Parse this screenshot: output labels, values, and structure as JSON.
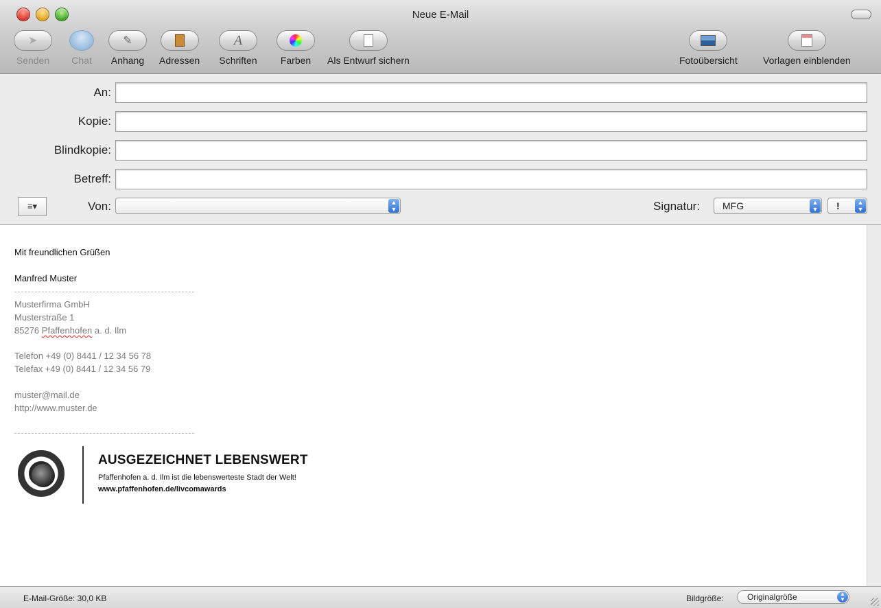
{
  "window": {
    "title": "Neue E-Mail"
  },
  "toolbar": {
    "send": "Senden",
    "chat": "Chat",
    "attach": "Anhang",
    "addresses": "Adressen",
    "fonts": "Schriften",
    "colors": "Farben",
    "draft": "Als Entwurf sichern",
    "photos": "Fotoübersicht",
    "templates": "Vorlagen einblenden"
  },
  "fields": {
    "to_label": "An:",
    "cc_label": "Kopie:",
    "bcc_label": "Blindkopie:",
    "subject_label": "Betreff:",
    "from_label": "Von:",
    "signature_label": "Signatur:",
    "signature_value": "MFG",
    "priority_value": "!"
  },
  "body": {
    "greeting": "Mit freundlichen Grüßen",
    "name": "Manfred Muster",
    "company": "Musterfirma GmbH",
    "street": "Musterstraße 1",
    "zip": "85276",
    "city_misspelled": "Pfaffenhofen",
    "city_rest": "a. d. Ilm",
    "phone": "Telefon +49 (0) 8441 / 12 34 56 78",
    "fax": "Telefax +49 (0) 8441 / 12 34 56 79",
    "email": "muster@mail.de",
    "web": "http://www.muster.de",
    "award_title": "AUSGEZEICHNET LEBENSWERT",
    "award_text": "Pfaffenhofen a. d. Ilm ist die lebenswerteste Stadt der Welt!",
    "award_url": "www.pfaffenhofen.de/livcomawards"
  },
  "status": {
    "mail_size": "E-Mail-Größe: 30,0 KB",
    "image_size_label": "Bildgröße:",
    "image_size_value": "Originalgröße"
  },
  "icons": [
    "send-icon",
    "chat-icon",
    "paperclip-icon",
    "address-book-icon",
    "font-icon",
    "color-wheel-icon",
    "draft-icon",
    "photo-browser-icon",
    "template-icon",
    "format-menu-icon"
  ]
}
